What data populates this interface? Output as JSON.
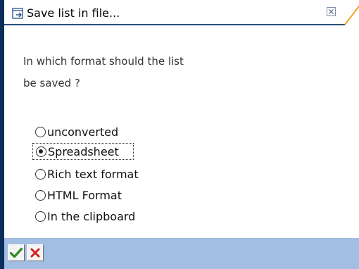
{
  "dialog": {
    "title": "Save list in file...",
    "question_line1": "In which format should the list",
    "question_line2": "be saved ?"
  },
  "options": [
    {
      "label": "unconverted",
      "selected": false
    },
    {
      "label": "Spreadsheet",
      "selected": true
    },
    {
      "label": "Rich text format",
      "selected": false
    },
    {
      "label": "HTML Format",
      "selected": false
    },
    {
      "label": "In the clipboard",
      "selected": false
    }
  ],
  "footer": {
    "buttons": [
      {
        "icon": "checkmark-icon",
        "color": "#2e8b1f"
      },
      {
        "icon": "cancel-x-icon",
        "color": "#d21f1f"
      }
    ]
  },
  "colors": {
    "title_accent": "#f0a22a",
    "footer_bar": "#a2bee3",
    "left_strip": "#0c2f5a"
  }
}
